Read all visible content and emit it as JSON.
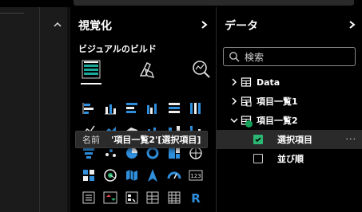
{
  "viz_pane": {
    "title": "視覚化",
    "build_label": "ビジュアルのビルド",
    "build_icons": [
      "table-build-icon",
      "format-paintbrush-icon",
      "analytics-magnifier-icon"
    ],
    "gallery_icons": [
      [
        "stacked-bar-icon",
        "stacked-column-icon",
        "clustered-bar-icon",
        "clustered-column-icon",
        "100-stacked-bar-icon",
        "100-stacked-column-icon"
      ],
      [
        "line-chart-icon",
        "area-chart-icon",
        "stacked-area-icon",
        "line-column-icon",
        "ribbon-chart-icon",
        "waterfall-icon"
      ],
      [
        "funnel-icon",
        "scatter-icon",
        "pie-icon",
        "donut-icon",
        "treemap-icon",
        "map-icon"
      ],
      [
        "filled-map-icon",
        "shape-map-icon",
        "azure-map-icon",
        "arrow-icon",
        "gauge-icon",
        "card-icon"
      ],
      [
        "multirow-card-icon",
        "kpi-icon",
        "slicer-icon",
        "table-icon",
        "matrix-icon",
        "r-visual-icon"
      ]
    ],
    "r_letter": "R",
    "card_text": "123"
  },
  "tooltip": {
    "label": "名前",
    "value": "'項目一覧2'[選択項目]"
  },
  "data_pane": {
    "title": "データ",
    "search_placeholder": "検索",
    "tables": [
      {
        "name": "Data",
        "expanded": false
      },
      {
        "name": "項目一覧1",
        "expanded": false
      },
      {
        "name": "項目一覧2",
        "expanded": true
      }
    ],
    "fields": [
      {
        "name": "選択項目",
        "checked": true,
        "more": "···"
      },
      {
        "name": "並び順",
        "checked": false
      }
    ]
  },
  "colors": {
    "accent_green": "#2bb673",
    "icon_blue": "#2f8fdd",
    "icon_teal": "#1aa89a"
  }
}
